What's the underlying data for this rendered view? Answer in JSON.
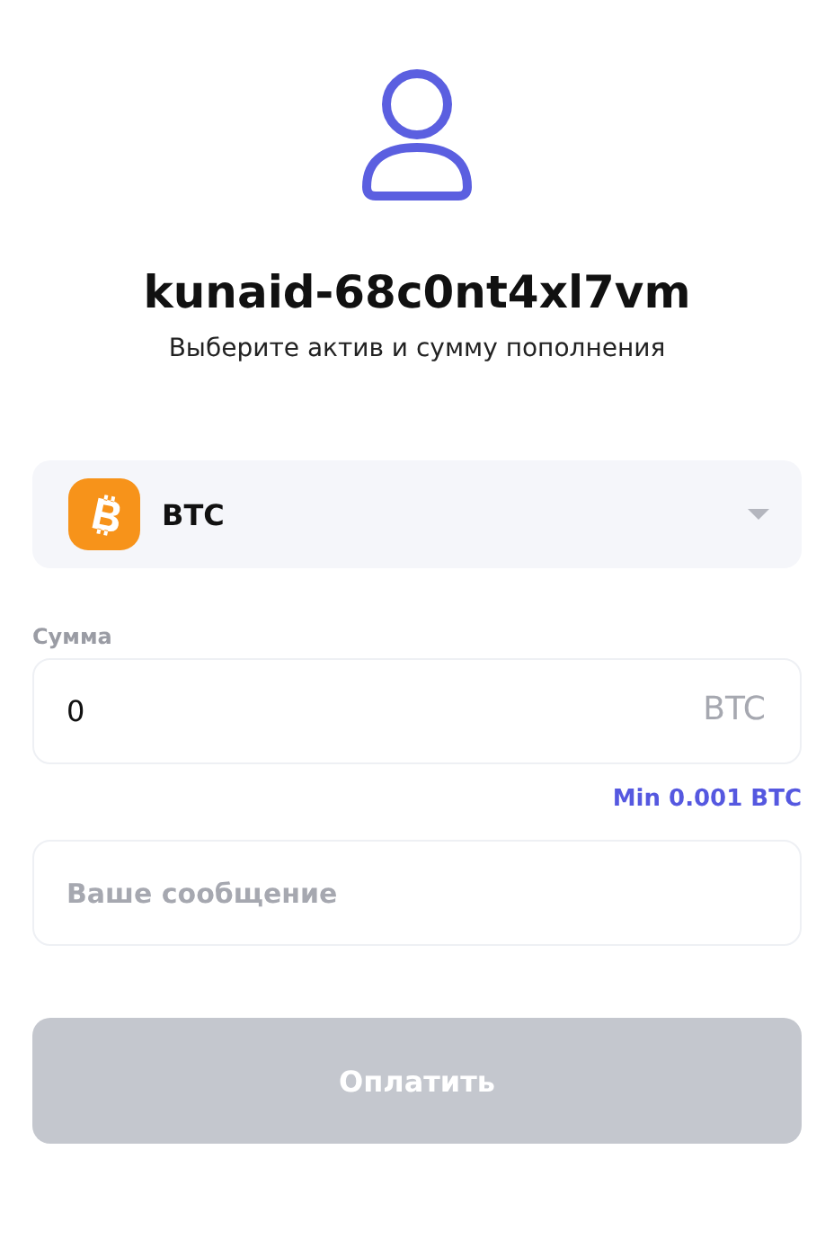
{
  "profile": {
    "username": "kunaid-68c0nt4xl7vm",
    "subtitle": "Выберите актив и сумму пополнения"
  },
  "asset_select": {
    "value": "BTC"
  },
  "amount": {
    "label": "Сумма",
    "value": "0",
    "unit": "BTC",
    "hint": "Min 0.001 BTC"
  },
  "message": {
    "placeholder": "Ваше сообщение"
  },
  "pay_button": {
    "label": "Оплатить",
    "disabled": true
  }
}
